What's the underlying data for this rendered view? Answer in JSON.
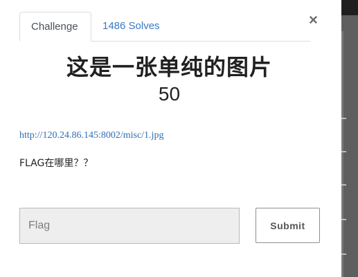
{
  "modal": {
    "close_glyph": "×",
    "tabs": [
      {
        "label": "Challenge",
        "active": true
      },
      {
        "label": "1486 Solves",
        "active": false
      }
    ],
    "challenge": {
      "title": "这是一张单纯的图片",
      "value": "50",
      "attachment_link": "http://120.24.86.145:8002/misc/1.jpg",
      "description": "FLAG在哪里？？"
    },
    "form": {
      "flag_placeholder": "Flag",
      "flag_value": "",
      "submit_label": "Submit"
    }
  },
  "colors": {
    "link": "#2f6db5",
    "tab_inactive": "#3a78c2",
    "input_background": "#eeeeee",
    "backdrop": "#5f5f5f"
  }
}
